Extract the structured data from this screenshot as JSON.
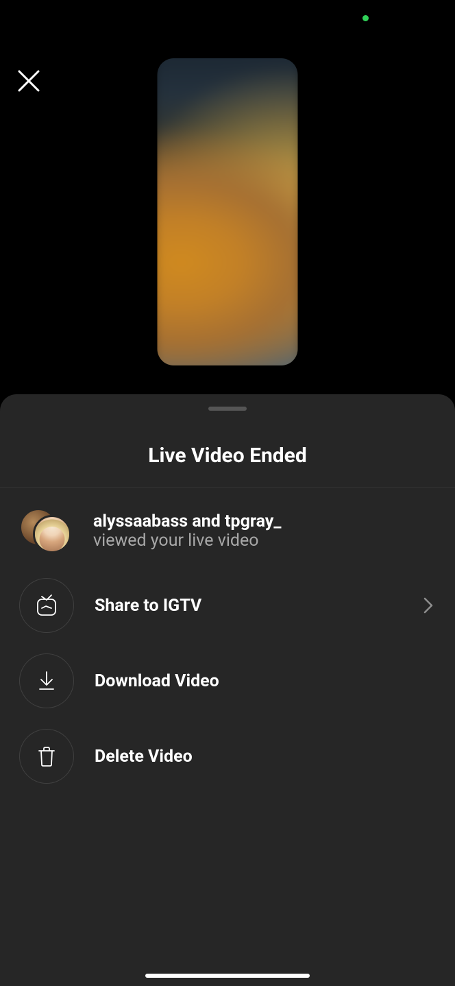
{
  "sheet": {
    "title": "Live Video Ended",
    "viewers_line_bold": "alyssaabass and tpgray_",
    "viewers_line_sub": "viewed your live video",
    "actions": {
      "share_igtv": "Share to IGTV",
      "download": "Download Video",
      "delete": "Delete Video"
    }
  }
}
